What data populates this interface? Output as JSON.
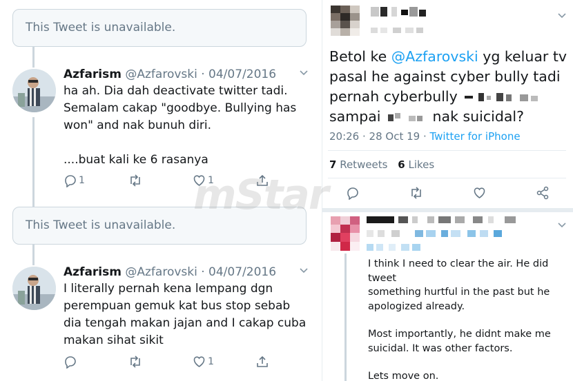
{
  "left": {
    "unavailable_1": "This Tweet is unavailable.",
    "unavailable_2": "This Tweet is unavailable.",
    "tweet1": {
      "name": "Azfarism",
      "handle_date": "@Azfarovski · 04/07/2016",
      "lines": [
        "ha ah. Dia dah deactivate twitter tadi.",
        "Semalam cakap \"goodbye. Bullying has",
        "won\" and nak bunuh diri.",
        "",
        "....buat kali ke 6 rasanya"
      ],
      "reply_count": "1",
      "like_count": "1"
    },
    "tweet2": {
      "name": "Azfarism",
      "handle_date": "@Azfarovski · 04/07/2016",
      "lines": [
        "I literally pernah kena lempang dgn",
        "perempuan gemuk kat bus stop sebab",
        "dia tengah makan jajan and I cakap cuba",
        "makan sihat sikit"
      ],
      "like_count": "1"
    }
  },
  "right": {
    "main": {
      "line1_prefix": "Betol ke ",
      "line1_mention": "@Azfarovski",
      "line1_suffix": " yg keluar tv",
      "line2": "pasal he against cyber bully tadi",
      "line3": "pernah cyberbully",
      "line4_a": "sampai",
      "line4_b": "nak suicidal?",
      "time": "20:26 · 28 Oct 19 · ",
      "client": "Twitter for iPhone",
      "retweets_num": "7",
      "retweets_label": " Retweets",
      "likes_num": "6",
      "likes_label": " Likes"
    },
    "reply": {
      "p1": [
        "I think I need to clear the air. He did tweet",
        "something hurtful in the past but he",
        "apologized already."
      ],
      "p2": [
        "Most importantly, he didnt make me",
        "suicidal. It was other factors."
      ],
      "p3": [
        "Lets move on."
      ]
    }
  },
  "watermark": "mStar",
  "colors": {
    "link": "#1da1f2",
    "muted": "#657786",
    "border": "#e6ecf0"
  }
}
